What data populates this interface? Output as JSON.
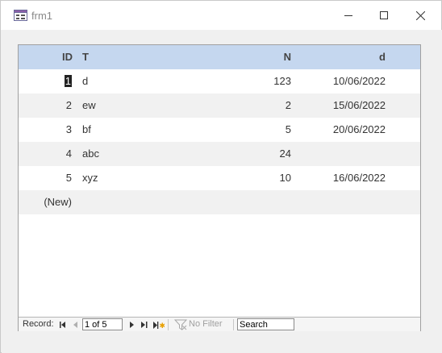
{
  "window": {
    "title": "frm1"
  },
  "table": {
    "headers": {
      "id": "ID",
      "t": "T",
      "n": "N",
      "d": "d"
    },
    "rows": [
      {
        "id": "1",
        "t": "d",
        "n": "123",
        "d": "10/06/2022"
      },
      {
        "id": "2",
        "t": "ew",
        "n": "2",
        "d": "15/06/2022"
      },
      {
        "id": "3",
        "t": "bf",
        "n": "5",
        "d": "20/06/2022"
      },
      {
        "id": "4",
        "t": "abc",
        "n": "24",
        "d": ""
      },
      {
        "id": "5",
        "t": "xyz",
        "n": "10",
        "d": "16/06/2022"
      }
    ],
    "new_row_label": "(New)"
  },
  "navigator": {
    "record_label": "Record:",
    "position": "1 of 5",
    "filter_label": "No Filter",
    "search_value": "Search"
  },
  "icons": {
    "app": "form-icon",
    "minimize": "minimize-icon",
    "maximize": "maximize-icon",
    "close": "close-icon",
    "first": "first-record-icon",
    "prev": "previous-record-icon",
    "next": "next-record-icon",
    "last": "last-record-icon",
    "new_record": "new-record-icon",
    "filter": "filter-icon"
  },
  "colors": {
    "header_background": "#c5d7ef",
    "alternate_row": "#f1f1f1",
    "new_record_star": "#e8a000"
  }
}
